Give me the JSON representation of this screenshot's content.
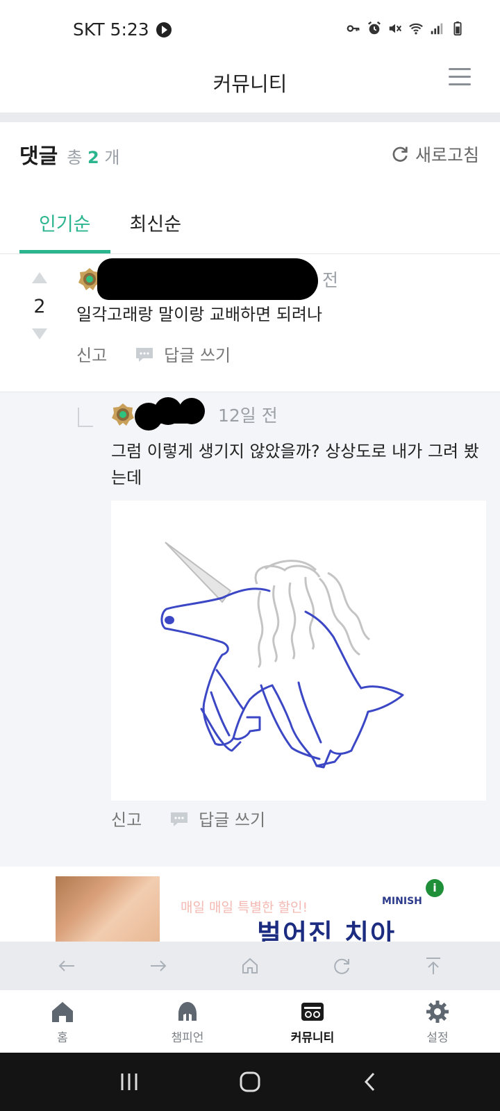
{
  "status_bar": {
    "carrier_time": "SKT 5:23",
    "icons": [
      "key-icon",
      "alarm-icon",
      "mute-icon",
      "wifi-icon",
      "signal-icon",
      "battery-icon"
    ]
  },
  "header": {
    "title": "커뮤니티",
    "menu_icon": "hamburger-menu-icon"
  },
  "comments": {
    "title": "댓글",
    "total_prefix": "총",
    "count": "2",
    "total_suffix": "개",
    "refresh_label": "새로고침",
    "tabs": [
      {
        "label": "인기순",
        "active": true
      },
      {
        "label": "최신순",
        "active": false
      }
    ],
    "items": [
      {
        "votes": "2",
        "time": "전",
        "text": "일각고래랑 말이랑 교배하면 되려나",
        "report_label": "신고",
        "reply_label": "답글 쓰기"
      },
      {
        "time": "12일 전",
        "text": "그럼 이렇게 생기지 않았을까? 상상도로 내가 그려 봤는데",
        "image_subject": "unicorn-drawing",
        "report_label": "신고",
        "reply_label": "답글 쓰기"
      }
    ]
  },
  "ad": {
    "faint_text": "매일 매일 특별한 할인!",
    "headline": "벌어진 치아",
    "brand": "MINISH"
  },
  "bottom_nav": [
    {
      "label": "홈",
      "icon": "home-icon",
      "active": false
    },
    {
      "label": "챔피언",
      "icon": "champion-icon",
      "active": false
    },
    {
      "label": "커뮤니티",
      "icon": "community-icon",
      "active": true
    },
    {
      "label": "설정",
      "icon": "gear-icon",
      "active": false
    }
  ],
  "colors": {
    "accent": "#2bb58f",
    "muted_text": "#9aa0a6",
    "reply_background": "#f4f5f8",
    "drawing_stroke": "#3b47c4"
  }
}
